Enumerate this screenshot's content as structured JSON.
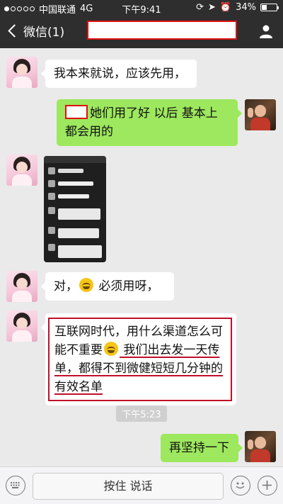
{
  "status_bar": {
    "carrier": "中国联通",
    "network": "4G",
    "time": "下午9:41",
    "battery": "34%",
    "battery_level": 0.34
  },
  "nav": {
    "back_label": "微信(1)"
  },
  "messages": [
    {
      "side": "left",
      "text": "我本来就说，应该先用，"
    },
    {
      "side": "right",
      "text": "她们用了好 以后 基本上都会用的"
    },
    {
      "side": "left",
      "type": "image"
    },
    {
      "side": "left",
      "text_before": "对，",
      "emoji": "grin-sweat-emoji",
      "text_after": " 必须用呀，"
    },
    {
      "side": "left",
      "line1": "互联网时代，用什么渠道怎么可",
      "line2a": "能不重要",
      "emoji": "grin-sweat-emoji",
      "line2b": " 我们出去发一天传",
      "line3": "单，都得不到微健短短几分钟的",
      "line4": "有效名单"
    },
    {
      "side": "right",
      "text": "再坚持一下"
    }
  ],
  "timestamp": "下午5:23",
  "input_bar": {
    "hold_to_talk": "按住 说话"
  }
}
